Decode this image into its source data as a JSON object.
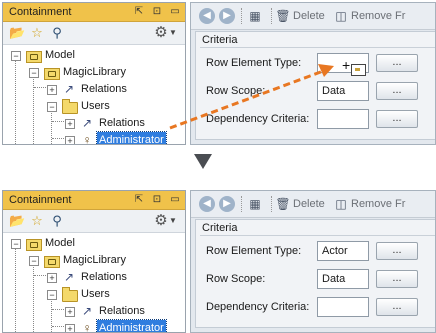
{
  "before": {
    "containment": {
      "title": "Containment",
      "title_buttons": [
        "⇱",
        "⊡",
        "▭"
      ],
      "toolbar_icons": [
        "open-folder-icon",
        "star-icon",
        "search-icon",
        "gear-icon"
      ],
      "tree": [
        {
          "label": "Model",
          "icon": "package-icon"
        },
        {
          "label": "MagicLibrary",
          "icon": "package-icon"
        },
        {
          "label": "Relations",
          "icon": "relations-icon"
        },
        {
          "label": "Users",
          "icon": "folder-icon"
        },
        {
          "label": "Relations",
          "icon": "relations-icon"
        },
        {
          "label": "Administrator",
          "icon": "actor-icon",
          "selected": true
        }
      ]
    },
    "criteria": {
      "toolbar": {
        "delete_label": "Delete",
        "remove_label": "Remove Fr"
      },
      "section_title": "Criteria",
      "rows": [
        {
          "label": "Row Element Type:",
          "value": "",
          "button": "..."
        },
        {
          "label": "Row Scope:",
          "value": "Data",
          "button": "..."
        },
        {
          "label": "Dependency Criteria:",
          "value": "",
          "button": "..."
        }
      ]
    },
    "colors": {
      "drag_arrow": "#e87722",
      "selection": "#2f7ddf",
      "panel_title": "#f0c24a"
    }
  },
  "after": {
    "containment": {
      "title": "Containment",
      "title_buttons": [
        "⇱",
        "⊡",
        "▭"
      ],
      "toolbar_icons": [
        "open-folder-icon",
        "star-icon",
        "search-icon",
        "gear-icon"
      ],
      "tree": [
        {
          "label": "Model",
          "icon": "package-icon"
        },
        {
          "label": "MagicLibrary",
          "icon": "package-icon"
        },
        {
          "label": "Relations",
          "icon": "relations-icon"
        },
        {
          "label": "Users",
          "icon": "folder-icon"
        },
        {
          "label": "Relations",
          "icon": "relations-icon"
        },
        {
          "label": "Administrator",
          "icon": "actor-icon",
          "selected": true
        }
      ]
    },
    "criteria": {
      "toolbar": {
        "delete_label": "Delete",
        "remove_label": "Remove Fr"
      },
      "section_title": "Criteria",
      "rows": [
        {
          "label": "Row Element Type:",
          "value": "Actor",
          "button": "..."
        },
        {
          "label": "Row Scope:",
          "value": "Data",
          "button": "..."
        },
        {
          "label": "Dependency Criteria:",
          "value": "",
          "button": "..."
        }
      ]
    }
  }
}
